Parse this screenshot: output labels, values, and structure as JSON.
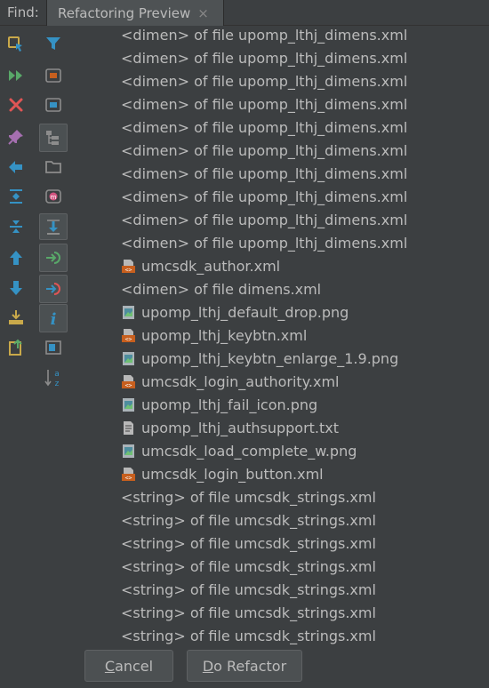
{
  "header": {
    "find_label": "Find:",
    "tab_label": "Refactoring Preview",
    "tab_close": "×"
  },
  "toolbar_left": [
    {
      "icon": "rerun-icon"
    },
    {
      "icon": "run-all-icon"
    },
    {
      "icon": "close-red-icon"
    },
    {
      "icon": "pin-icon"
    },
    {
      "icon": "back-arrow-icon"
    },
    {
      "icon": "expand-all-icon"
    },
    {
      "icon": "collapse-all-icon"
    },
    {
      "icon": "previous-occurrence-icon"
    },
    {
      "icon": "next-occurrence-icon"
    },
    {
      "icon": "export-icon"
    },
    {
      "icon": "open-in-new-icon"
    }
  ],
  "toolbar_right": [
    {
      "icon": "filter-icon"
    },
    {
      "icon": "group-by-module-icon"
    },
    {
      "icon": "group-by-type-icon"
    },
    {
      "icon": "group-by-directory-icon"
    },
    {
      "icon": "group-by-package-icon"
    },
    {
      "icon": "merge-icon"
    },
    {
      "icon": "autoscroll-to-source-icon"
    },
    {
      "icon": "navigate-in-icon"
    },
    {
      "icon": "navigate-out-icon"
    },
    {
      "icon": "info-icon"
    },
    {
      "icon": "preview-icon"
    },
    {
      "icon": "sort-alphabetically-icon"
    }
  ],
  "tree": {
    "rows": [
      {
        "text": "<dimen> of file upomp_lthj_dimens.xml",
        "icon": ""
      },
      {
        "text": "<dimen> of file upomp_lthj_dimens.xml",
        "icon": ""
      },
      {
        "text": "<dimen> of file upomp_lthj_dimens.xml",
        "icon": ""
      },
      {
        "text": "<dimen> of file upomp_lthj_dimens.xml",
        "icon": ""
      },
      {
        "text": "<dimen> of file upomp_lthj_dimens.xml",
        "icon": ""
      },
      {
        "text": "<dimen> of file upomp_lthj_dimens.xml",
        "icon": ""
      },
      {
        "text": "<dimen> of file upomp_lthj_dimens.xml",
        "icon": ""
      },
      {
        "text": "<dimen> of file upomp_lthj_dimens.xml",
        "icon": ""
      },
      {
        "text": "<dimen> of file upomp_lthj_dimens.xml",
        "icon": ""
      },
      {
        "text": "<dimen> of file upomp_lthj_dimens.xml",
        "icon": ""
      },
      {
        "text": "umcsdk_author.xml",
        "icon": "xml-file-icon"
      },
      {
        "text": "<dimen> of file dimens.xml",
        "icon": ""
      },
      {
        "text": "upomp_lthj_default_drop.png",
        "icon": "image-file-icon"
      },
      {
        "text": "upomp_lthj_keybtn.xml",
        "icon": "xml-file-icon"
      },
      {
        "text": "upomp_lthj_keybtn_enlarge_1.9.png",
        "icon": "image-file-icon"
      },
      {
        "text": "umcsdk_login_authority.xml",
        "icon": "xml-file-icon"
      },
      {
        "text": "upomp_lthj_fail_icon.png",
        "icon": "image-file-icon"
      },
      {
        "text": "upomp_lthj_authsupport.txt",
        "icon": "text-file-icon"
      },
      {
        "text": "umcsdk_load_complete_w.png",
        "icon": "image-file-icon"
      },
      {
        "text": "umcsdk_login_button.xml",
        "icon": "xml-file-icon"
      },
      {
        "text": "<string> of file umcsdk_strings.xml",
        "icon": ""
      },
      {
        "text": "<string> of file umcsdk_strings.xml",
        "icon": ""
      },
      {
        "text": "<string> of file umcsdk_strings.xml",
        "icon": ""
      },
      {
        "text": "<string> of file umcsdk_strings.xml",
        "icon": ""
      },
      {
        "text": "<string> of file umcsdk_strings.xml",
        "icon": ""
      },
      {
        "text": "<string> of file umcsdk_strings.xml",
        "icon": ""
      },
      {
        "text": "<string> of file umcsdk_strings.xml",
        "icon": ""
      }
    ]
  },
  "buttons": {
    "cancel_mnemonic": "C",
    "cancel_rest": "ancel",
    "refactor_mnemonic": "D",
    "refactor_rest": "o Refactor"
  },
  "colors": {
    "background": "#3c3f41",
    "text": "#bbbbbb",
    "accent_blue": "#3592c4",
    "accent_green": "#59a869",
    "accent_red": "#e05555",
    "xml_orange": "#c75f1e"
  }
}
